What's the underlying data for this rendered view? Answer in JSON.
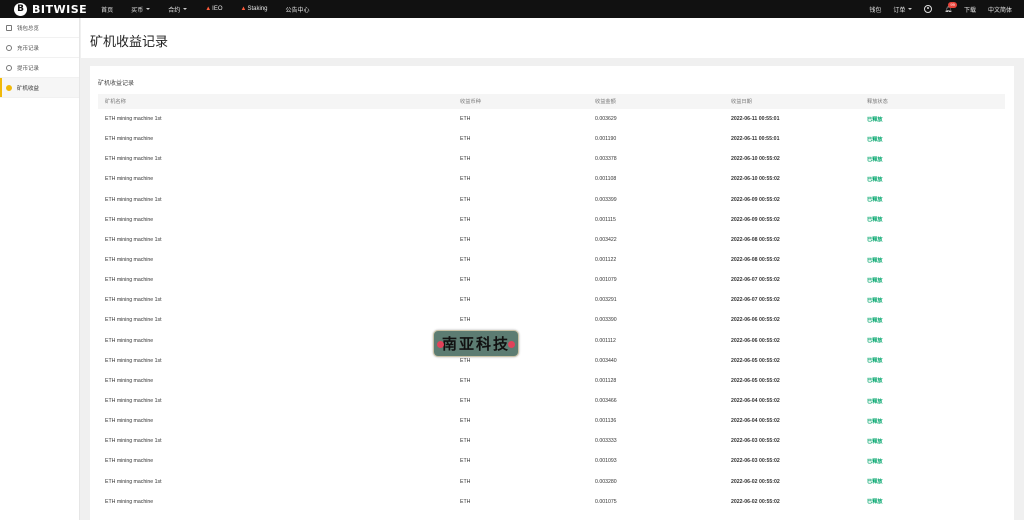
{
  "topbar": {
    "logo_mark": "B",
    "logo_text": "BITWISE",
    "nav": [
      {
        "label": "首页",
        "dropdown": false,
        "fire": false
      },
      {
        "label": "买币",
        "dropdown": true,
        "fire": false
      },
      {
        "label": "合约",
        "dropdown": true,
        "fire": false
      },
      {
        "label": "IEO",
        "dropdown": false,
        "fire": true
      },
      {
        "label": "Staking",
        "dropdown": false,
        "fire": true
      },
      {
        "label": "公告中心",
        "dropdown": false,
        "fire": false
      }
    ],
    "right": {
      "wallet": "钱包",
      "orders": "订单",
      "notifications_badge": "99",
      "download": "下载",
      "language": "中文简体"
    }
  },
  "sidebar": {
    "items": [
      {
        "label": "钱包总览",
        "icon": "wallet-icon",
        "active": false
      },
      {
        "label": "充币记录",
        "icon": "deposit-icon",
        "active": false
      },
      {
        "label": "提币记录",
        "icon": "withdraw-icon",
        "active": false
      },
      {
        "label": "矿机收益",
        "icon": "mining-icon",
        "active": true
      }
    ]
  },
  "page": {
    "title": "矿机收益记录"
  },
  "card": {
    "title": "矿机收益记录",
    "columns": [
      "矿机名称",
      "收益币种",
      "收益金额",
      "收益日期",
      "释放状态"
    ],
    "rows": [
      [
        "ETH mining machine 1st",
        "ETH",
        "0.003629",
        "2022-06-11 00:55:01",
        "已释放"
      ],
      [
        "ETH mining machine",
        "ETH",
        "0.001190",
        "2022-06-11 00:55:01",
        "已释放"
      ],
      [
        "ETH mining machine 1st",
        "ETH",
        "0.003378",
        "2022-06-10 00:55:02",
        "已释放"
      ],
      [
        "ETH mining machine",
        "ETH",
        "0.001108",
        "2022-06-10 00:55:02",
        "已释放"
      ],
      [
        "ETH mining machine 1st",
        "ETH",
        "0.003399",
        "2022-06-09 00:55:02",
        "已释放"
      ],
      [
        "ETH mining machine",
        "ETH",
        "0.001115",
        "2022-06-09 00:55:02",
        "已释放"
      ],
      [
        "ETH mining machine 1st",
        "ETH",
        "0.003422",
        "2022-06-08 00:55:02",
        "已释放"
      ],
      [
        "ETH mining machine",
        "ETH",
        "0.001122",
        "2022-06-08 00:55:02",
        "已释放"
      ],
      [
        "ETH mining machine",
        "ETH",
        "0.001079",
        "2022-06-07 00:55:02",
        "已释放"
      ],
      [
        "ETH mining machine 1st",
        "ETH",
        "0.003291",
        "2022-06-07 00:55:02",
        "已释放"
      ],
      [
        "ETH mining machine 1st",
        "ETH",
        "0.003390",
        "2022-06-06 00:55:02",
        "已释放"
      ],
      [
        "ETH mining machine",
        "ETH",
        "0.001112",
        "2022-06-06 00:55:02",
        "已释放"
      ],
      [
        "ETH mining machine 1st",
        "ETH",
        "0.003440",
        "2022-06-05 00:55:02",
        "已释放"
      ],
      [
        "ETH mining machine",
        "ETH",
        "0.001128",
        "2022-06-05 00:55:02",
        "已释放"
      ],
      [
        "ETH mining machine 1st",
        "ETH",
        "0.003466",
        "2022-06-04 00:55:02",
        "已释放"
      ],
      [
        "ETH mining machine",
        "ETH",
        "0.001136",
        "2022-06-04 00:55:02",
        "已释放"
      ],
      [
        "ETH mining machine 1st",
        "ETH",
        "0.003333",
        "2022-06-03 00:55:02",
        "已释放"
      ],
      [
        "ETH mining machine",
        "ETH",
        "0.001093",
        "2022-06-03 00:55:02",
        "已释放"
      ],
      [
        "ETH mining machine 1st",
        "ETH",
        "0.003280",
        "2022-06-02 00:55:02",
        "已释放"
      ],
      [
        "ETH mining machine",
        "ETH",
        "0.001075",
        "2022-06-02 00:55:02",
        "已释放"
      ]
    ]
  },
  "watermark": {
    "text": "南亚科技"
  },
  "colors": {
    "accent": "#f0b90b",
    "status_green": "#03a66d",
    "topbar_bg": "#111111",
    "badge_red": "#e8433a"
  }
}
